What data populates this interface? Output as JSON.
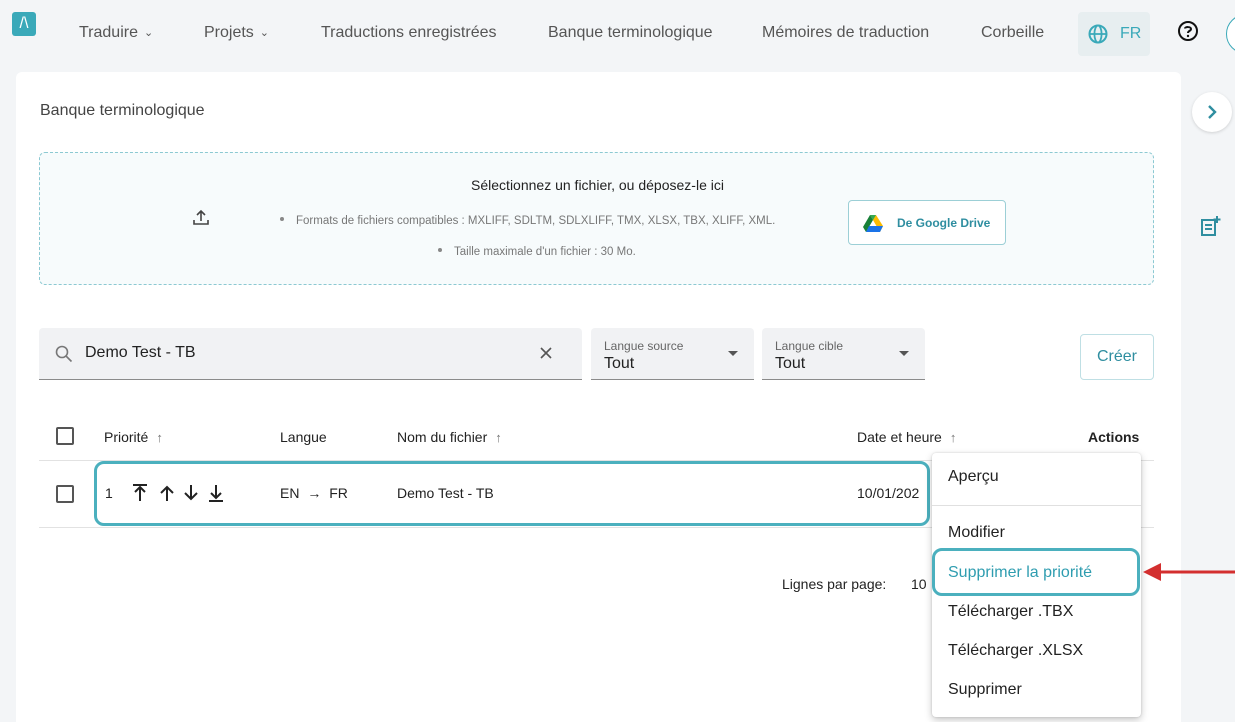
{
  "nav": {
    "logo": "/\\",
    "items": [
      {
        "label": "Traduire",
        "dropdown": true
      },
      {
        "label": "Projets",
        "dropdown": true
      },
      {
        "label": "Traductions enregistrées",
        "dropdown": false
      },
      {
        "label": "Banque terminologique",
        "dropdown": false
      },
      {
        "label": "Mémoires de traduction",
        "dropdown": false
      },
      {
        "label": "Corbeille",
        "dropdown": false
      }
    ],
    "language": "FR",
    "icons": {
      "language": "globe-icon",
      "help": "help-circle-icon"
    }
  },
  "page": {
    "breadcrumb": "Banque terminologique"
  },
  "upload": {
    "title": "Sélectionnez un fichier, ou déposez-le ici",
    "formats": "Formats de fichiers compatibles : MXLIFF, SDLTM, SDLXLIFF, TMX, XLSX, TBX, XLIFF, XML.",
    "max_size": "Taille maximale d'un fichier : 30 Mo.",
    "drive_button": "De Google Drive",
    "icon": "upload-icon"
  },
  "filters": {
    "search_value": "Demo Test - TB",
    "source": {
      "label": "Langue source",
      "value": "Tout"
    },
    "target": {
      "label": "Langue cible",
      "value": "Tout"
    },
    "create_button": "Créer"
  },
  "table": {
    "headers": {
      "priority": "Priorité",
      "language": "Langue",
      "filename": "Nom du fichier",
      "datetime": "Date et heure",
      "actions": "Actions"
    },
    "rows": [
      {
        "priority": "1",
        "source_lang": "EN",
        "arrow": "→",
        "target_lang": "FR",
        "filename": "Demo Test - TB",
        "datetime": "10/01/202"
      }
    ]
  },
  "pagination": {
    "rows_per_page_label": "Lignes par page:",
    "rows_per_page_value": "10"
  },
  "menu": {
    "items": [
      "Aperçu",
      "Modifier",
      "Supprimer la priorité",
      "Télécharger .TBX",
      "Télécharger .XLSX",
      "Supprimer"
    ],
    "highlighted": "Supprimer la priorité"
  },
  "colors": {
    "accent": "#3aa9b9",
    "annotation_arrow": "#d32f2f"
  }
}
